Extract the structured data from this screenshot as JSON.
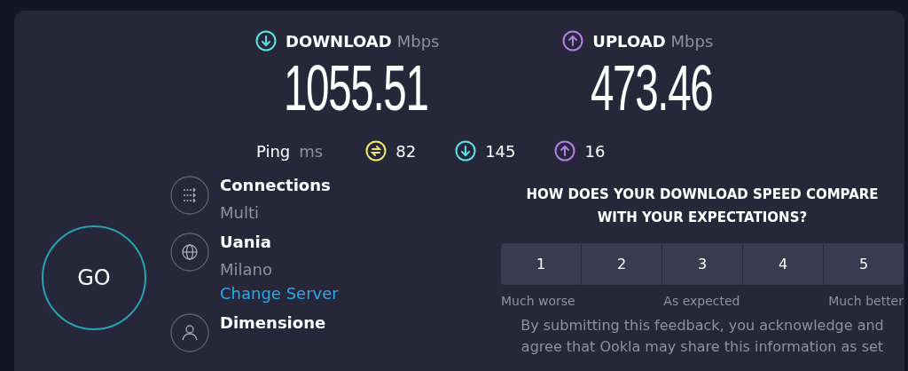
{
  "speeds": [
    {
      "kind": "download",
      "label": "DOWNLOAD",
      "unit": "Mbps",
      "value": "1055.51"
    },
    {
      "kind": "upload",
      "label": "UPLOAD",
      "unit": "Mbps",
      "value": "473.46"
    }
  ],
  "ping": {
    "label": "Ping",
    "unit": "ms",
    "items": [
      {
        "kind": "idle",
        "value": "82"
      },
      {
        "kind": "download",
        "value": "145"
      },
      {
        "kind": "upload",
        "value": "16"
      }
    ]
  },
  "go_button": "GO",
  "details": [
    {
      "kind": "connections",
      "title": "Connections",
      "value": "Multi"
    },
    {
      "kind": "server",
      "title": "Uania",
      "value": "Milano",
      "link": "Change Server"
    },
    {
      "kind": "user",
      "title": "Dimensione"
    }
  ],
  "feedback": {
    "question": "HOW DOES YOUR DOWNLOAD SPEED COMPARE WITH YOUR EXPECTATIONS?",
    "options": [
      {
        "label": "1",
        "selected": false
      },
      {
        "label": "2",
        "selected": false
      },
      {
        "label": "3",
        "selected": false
      },
      {
        "label": "4",
        "selected": false
      },
      {
        "label": "5",
        "selected": false
      }
    ],
    "scale_labels": [
      "Much worse",
      "As expected",
      "Much better"
    ],
    "notice": "By submitting this feedback, you acknowledge and agree that Ookla may share this information as set"
  }
}
